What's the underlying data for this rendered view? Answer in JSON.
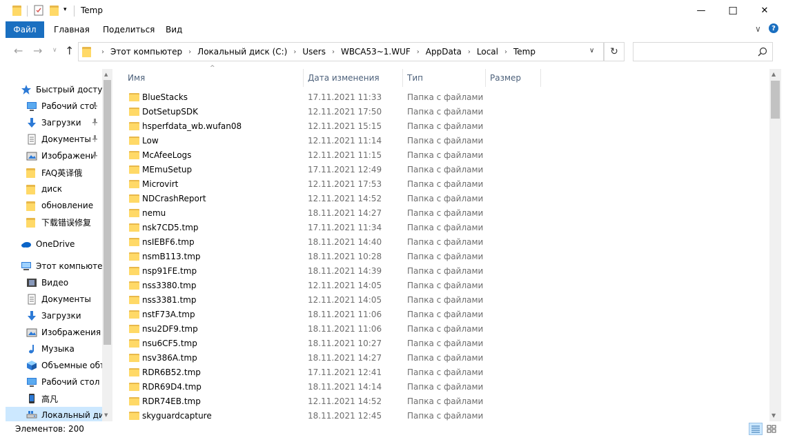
{
  "window": {
    "title": "Temp",
    "controls": {
      "minimize": "—",
      "maximize": "☐",
      "close": "✕"
    }
  },
  "ribbon": {
    "tabs": [
      "Файл",
      "Главная",
      "Поделиться",
      "Вид"
    ],
    "expand_symbol": "∨",
    "help_symbol": "?"
  },
  "navigation": {
    "back": "←",
    "forward": "→",
    "recent": "∨",
    "up": "↑"
  },
  "address": {
    "crumbs": [
      "Этот компьютер",
      "Локальный диск (C:)",
      "Users",
      "WBCA53~1.WUF",
      "AppData",
      "Local",
      "Temp"
    ],
    "separator": "›",
    "dropdown": "∨",
    "refresh": "↻"
  },
  "search": {
    "placeholder": "",
    "icon": "search-icon"
  },
  "sidebar": {
    "items": [
      {
        "label": "Быстрый доступ",
        "icon": "star-icon",
        "pinned": false
      },
      {
        "label": "Рабочий сто.",
        "icon": "desktop-icon",
        "pinned": true
      },
      {
        "label": "Загрузки",
        "icon": "download-icon",
        "pinned": true
      },
      {
        "label": "Документы",
        "icon": "document-icon",
        "pinned": true
      },
      {
        "label": "Изображени",
        "icon": "pictures-icon",
        "pinned": true
      },
      {
        "label": "FAQ英译俄",
        "icon": "folder-icon",
        "pinned": false
      },
      {
        "label": "диск",
        "icon": "folder-icon",
        "pinned": false
      },
      {
        "label": "обновление",
        "icon": "folder-icon",
        "pinned": false
      },
      {
        "label": "下载错误修复",
        "icon": "folder-icon",
        "pinned": false
      },
      {
        "label": "OneDrive",
        "icon": "cloud-icon",
        "pinned": false
      },
      {
        "label": "Этот компьютер",
        "icon": "computer-icon",
        "pinned": false
      },
      {
        "label": "Видео",
        "icon": "video-icon",
        "pinned": false
      },
      {
        "label": "Документы",
        "icon": "document-icon",
        "pinned": false
      },
      {
        "label": "Загрузки",
        "icon": "download-icon",
        "pinned": false
      },
      {
        "label": "Изображения",
        "icon": "pictures-icon",
        "pinned": false
      },
      {
        "label": "Музыка",
        "icon": "music-icon",
        "pinned": false
      },
      {
        "label": "Объемные объ",
        "icon": "3d-objects-icon",
        "pinned": false
      },
      {
        "label": "Рабочий стол",
        "icon": "desktop-icon",
        "pinned": false
      },
      {
        "label": "高凡",
        "icon": "phone-icon",
        "pinned": false
      },
      {
        "label": "Локальный дис",
        "icon": "drive-icon",
        "pinned": false,
        "selected": true
      }
    ],
    "pin_symbol": "📌"
  },
  "columns": {
    "name": "Имя",
    "date": "Дата изменения",
    "type": "Тип",
    "size": "Размер",
    "sort_symbol": "^"
  },
  "files": [
    {
      "name": "BlueStacks",
      "date": "17.11.2021 11:33",
      "type": "Папка с файлами"
    },
    {
      "name": "DotSetupSDK",
      "date": "12.11.2021 17:50",
      "type": "Папка с файлами"
    },
    {
      "name": "hsperfdata_wb.wufan08",
      "date": "12.11.2021 15:15",
      "type": "Папка с файлами"
    },
    {
      "name": "Low",
      "date": "12.11.2021 11:14",
      "type": "Папка с файлами"
    },
    {
      "name": "McAfeeLogs",
      "date": "12.11.2021 11:15",
      "type": "Папка с файлами"
    },
    {
      "name": "MEmuSetup",
      "date": "17.11.2021 12:49",
      "type": "Папка с файлами"
    },
    {
      "name": "Microvirt",
      "date": "12.11.2021 17:53",
      "type": "Папка с файлами"
    },
    {
      "name": "NDCrashReport",
      "date": "12.11.2021 14:52",
      "type": "Папка с файлами"
    },
    {
      "name": "nemu",
      "date": "18.11.2021 14:27",
      "type": "Папка с файлами"
    },
    {
      "name": "nsk7CD5.tmp",
      "date": "17.11.2021 11:34",
      "type": "Папка с файлами"
    },
    {
      "name": "nsIEBF6.tmp",
      "date": "18.11.2021 14:40",
      "type": "Папка с файлами"
    },
    {
      "name": "nsmB113.tmp",
      "date": "18.11.2021 10:28",
      "type": "Папка с файлами"
    },
    {
      "name": "nsp91FE.tmp",
      "date": "18.11.2021 14:39",
      "type": "Папка с файлами"
    },
    {
      "name": "nss3380.tmp",
      "date": "12.11.2021 14:05",
      "type": "Папка с файлами"
    },
    {
      "name": "nss3381.tmp",
      "date": "12.11.2021 14:05",
      "type": "Папка с файлами"
    },
    {
      "name": "nstF73A.tmp",
      "date": "18.11.2021 11:06",
      "type": "Папка с файлами"
    },
    {
      "name": "nsu2DF9.tmp",
      "date": "18.11.2021 11:06",
      "type": "Папка с файлами"
    },
    {
      "name": "nsu6CF5.tmp",
      "date": "18.11.2021 10:27",
      "type": "Папка с файлами"
    },
    {
      "name": "nsv386A.tmp",
      "date": "18.11.2021 14:27",
      "type": "Папка с файлами"
    },
    {
      "name": "RDR6B52.tmp",
      "date": "17.11.2021 12:41",
      "type": "Папка с файлами"
    },
    {
      "name": "RDR69D4.tmp",
      "date": "18.11.2021 14:14",
      "type": "Папка с файлами"
    },
    {
      "name": "RDR74EB.tmp",
      "date": "12.11.2021 14:52",
      "type": "Папка с файлами"
    },
    {
      "name": "skyguardcapture",
      "date": "18.11.2021 12:45",
      "type": "Папка с файлами"
    }
  ],
  "status": {
    "text": "Элементов: 200"
  }
}
